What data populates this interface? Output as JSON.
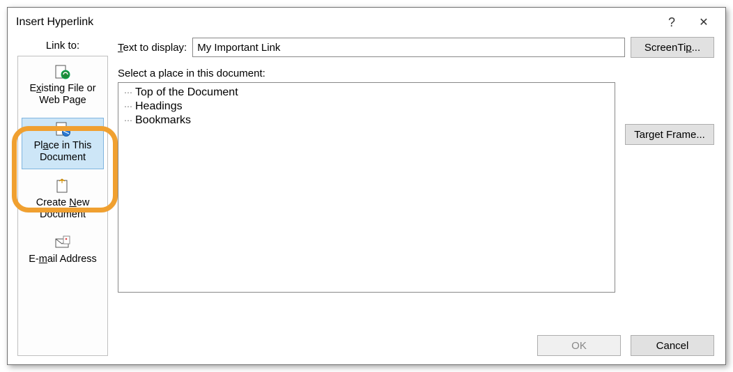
{
  "titlebar": {
    "title": "Insert Hyperlink",
    "help": "?",
    "close": "✕"
  },
  "sidebar": {
    "caption": "Link to:",
    "items": [
      {
        "line1_pre": "E",
        "line1_u": "x",
        "line1_post": "isting File or",
        "line2": "Web Page"
      },
      {
        "line1_pre": "Pl",
        "line1_u": "a",
        "line1_post": "ce in This",
        "line2": "Document"
      },
      {
        "line1_pre": "Create ",
        "line1_u": "N",
        "line1_post": "ew",
        "line2": "Document"
      },
      {
        "line1_pre": "E-",
        "line1_u": "m",
        "line1_post": "ail Address",
        "line2": ""
      }
    ]
  },
  "main": {
    "display_label_pre": "",
    "display_label_u": "T",
    "display_label_post": "ext to display:",
    "display_value": "My Important Link",
    "screentip_pre": "ScreenTi",
    "screentip_u": "p",
    "screentip_post": "...",
    "section_label": "Select a place in this document:",
    "tree": [
      "Top of the Document",
      "Headings",
      "Bookmarks"
    ],
    "target_frame_pre": "Tar",
    "target_frame_u": "g",
    "target_frame_post": "et Frame..."
  },
  "footer": {
    "ok": "OK",
    "cancel": "Cancel"
  }
}
